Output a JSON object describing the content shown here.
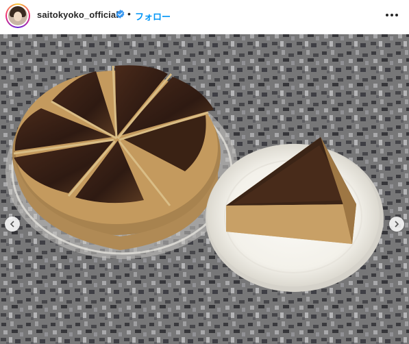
{
  "post": {
    "username": "saitokyoko_official",
    "follow_label": "フォロー",
    "separator": "•"
  },
  "colors": {
    "accent": "#0095f6",
    "text": "#262626",
    "verified": "#3897f0"
  },
  "icons": [
    "verified-badge-icon",
    "more-options-icon",
    "carousel-prev-icon",
    "carousel-next-icon"
  ]
}
